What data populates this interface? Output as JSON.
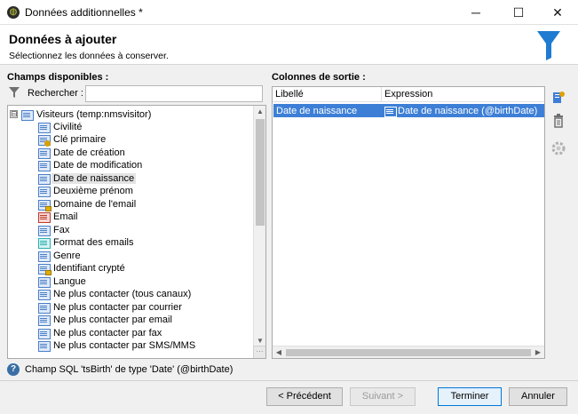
{
  "window": {
    "title": "Données additionnelles *",
    "minimize_glyph": "─",
    "maximize_glyph": "☐",
    "close_glyph": "✕"
  },
  "header": {
    "title": "Données à ajouter",
    "subtitle": "Sélectionnez les données à conserver.",
    "icon": "funnel-icon",
    "accent_color": "#1e7bd1"
  },
  "available": {
    "label": "Champs disponibles :",
    "search_label": "Rechercher :",
    "search_value": "",
    "root": {
      "expander": "⊟",
      "label": "Visiteurs (temp:nmsvisitor)"
    },
    "items": [
      {
        "label": "Civilité",
        "icon": "field-icon"
      },
      {
        "label": "Clé primaire",
        "icon": "key-field-icon"
      },
      {
        "label": "Date de création",
        "icon": "field-icon"
      },
      {
        "label": "Date de modification",
        "icon": "field-icon"
      },
      {
        "label": "Date de naissance",
        "icon": "field-icon",
        "selected": true
      },
      {
        "label": "Deuxième prénom",
        "icon": "field-icon"
      },
      {
        "label": "Domaine de l'email",
        "icon": "computed-field-icon"
      },
      {
        "label": "Email",
        "icon": "email-field-icon"
      },
      {
        "label": "Fax",
        "icon": "field-icon"
      },
      {
        "label": "Format des emails",
        "icon": "enum-field-icon"
      },
      {
        "label": "Genre",
        "icon": "field-icon"
      },
      {
        "label": "Identifiant crypté",
        "icon": "computed-field-icon"
      },
      {
        "label": "Langue",
        "icon": "field-icon"
      },
      {
        "label": "Ne plus contacter (tous canaux)",
        "icon": "field-icon"
      },
      {
        "label": "Ne plus contacter par courrier",
        "icon": "field-icon"
      },
      {
        "label": "Ne plus contacter par email",
        "icon": "field-icon"
      },
      {
        "label": "Ne plus contacter par fax",
        "icon": "field-icon"
      },
      {
        "label": "Ne plus contacter par SMS/MMS",
        "icon": "field-icon"
      }
    ]
  },
  "output": {
    "label": "Colonnes de sortie :",
    "columns": [
      "Libellé",
      "Expression"
    ],
    "rows": [
      {
        "label": "Date de naissance",
        "expression": "Date de naissance (@birthDate)"
      }
    ]
  },
  "status": {
    "text": "Champ SQL 'tsBirth' de type 'Date' (@birthDate)"
  },
  "buttons": {
    "previous": "< Précédent",
    "next": "Suivant >",
    "finish": "Terminer",
    "cancel": "Annuler"
  }
}
